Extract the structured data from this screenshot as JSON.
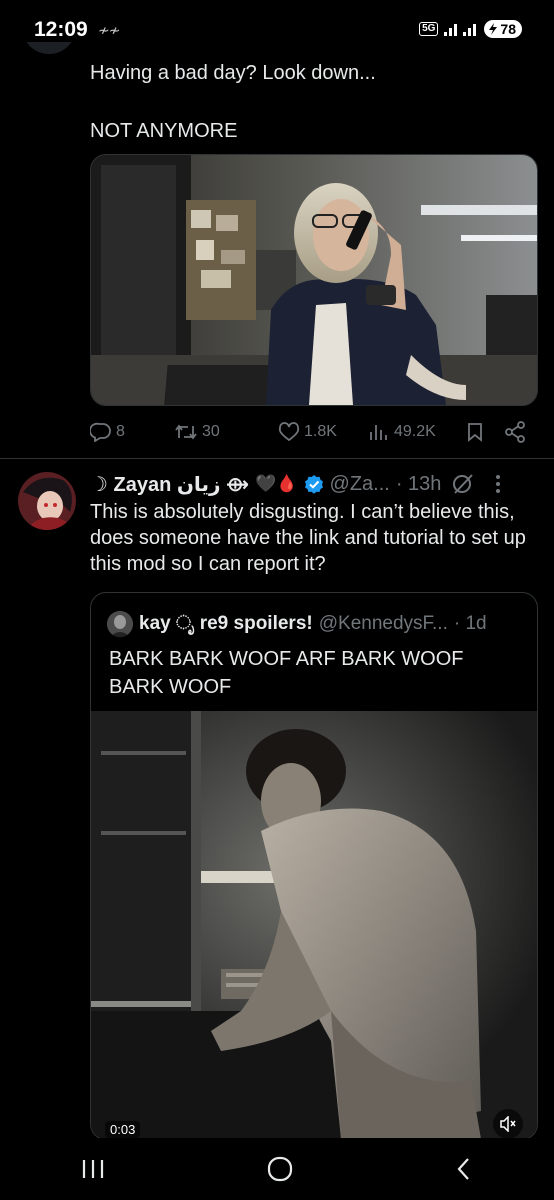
{
  "status_bar": {
    "time": "12:09",
    "extra": "≁≁",
    "network": "5G",
    "battery": "78"
  },
  "tweet1": {
    "line1": "Having a bad day? Look down...",
    "line2": "NOT ANYMORE",
    "stats": {
      "replies": "8",
      "reposts": "30",
      "likes": "1.8K",
      "views": "49.2K"
    }
  },
  "tweet2": {
    "name": "☽ Zayan زيان ⟴",
    "emoji": "🖤🩸",
    "handle": "@Za...",
    "time": "· 13h",
    "text": "This is absolutely disgusting. I can’t believe this, does someone have the link and tutorial to set up this mod so I can report it?",
    "quote": {
      "name": "kay ೃ re9 spoilers!",
      "handle": "@KennedysF...",
      "time": "· 1d",
      "text": "BARK BARK WOOF ARF BARK WOOF BARK WOOF",
      "video_time": "0:03"
    }
  },
  "colors": {
    "verified": "#1d9bf0",
    "muted": "#71767b",
    "divider": "#2f3336"
  }
}
